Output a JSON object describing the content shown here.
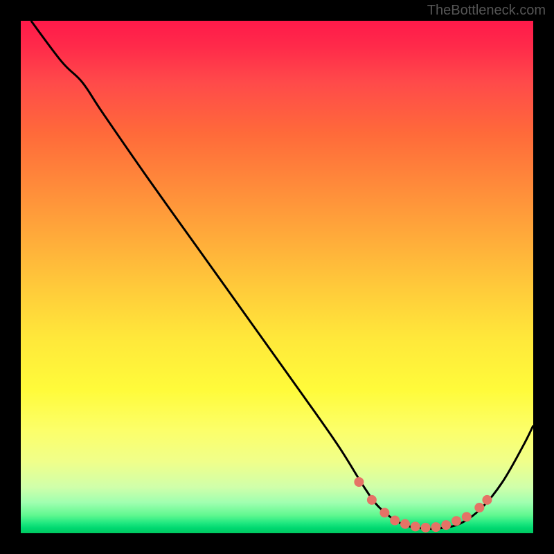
{
  "attribution": "TheBottleneck.com",
  "chart_data": {
    "type": "line",
    "title": "",
    "xlabel": "",
    "ylabel": "",
    "xlim": [
      0,
      100
    ],
    "ylim": [
      0,
      100
    ],
    "curve_points": [
      {
        "x": 2,
        "y": 100
      },
      {
        "x": 8,
        "y": 92
      },
      {
        "x": 12,
        "y": 88
      },
      {
        "x": 16,
        "y": 82
      },
      {
        "x": 25,
        "y": 69
      },
      {
        "x": 35,
        "y": 55
      },
      {
        "x": 45,
        "y": 41
      },
      {
        "x": 55,
        "y": 27
      },
      {
        "x": 62,
        "y": 17
      },
      {
        "x": 67,
        "y": 9
      },
      {
        "x": 70,
        "y": 5
      },
      {
        "x": 74,
        "y": 2
      },
      {
        "x": 78,
        "y": 1
      },
      {
        "x": 82,
        "y": 1
      },
      {
        "x": 86,
        "y": 2
      },
      {
        "x": 90,
        "y": 5
      },
      {
        "x": 94,
        "y": 10
      },
      {
        "x": 98,
        "y": 17
      },
      {
        "x": 100,
        "y": 21
      }
    ],
    "markers": [
      {
        "x": 66,
        "y": 10
      },
      {
        "x": 68.5,
        "y": 6.5
      },
      {
        "x": 71,
        "y": 4
      },
      {
        "x": 73,
        "y": 2.5
      },
      {
        "x": 75,
        "y": 1.8
      },
      {
        "x": 77,
        "y": 1.3
      },
      {
        "x": 79,
        "y": 1.1
      },
      {
        "x": 81,
        "y": 1.2
      },
      {
        "x": 83,
        "y": 1.6
      },
      {
        "x": 85,
        "y": 2.4
      },
      {
        "x": 87,
        "y": 3.2
      },
      {
        "x": 89.5,
        "y": 5
      },
      {
        "x": 91,
        "y": 6.5
      }
    ],
    "marker_color": "#e57366",
    "curve_color": "#000000"
  }
}
